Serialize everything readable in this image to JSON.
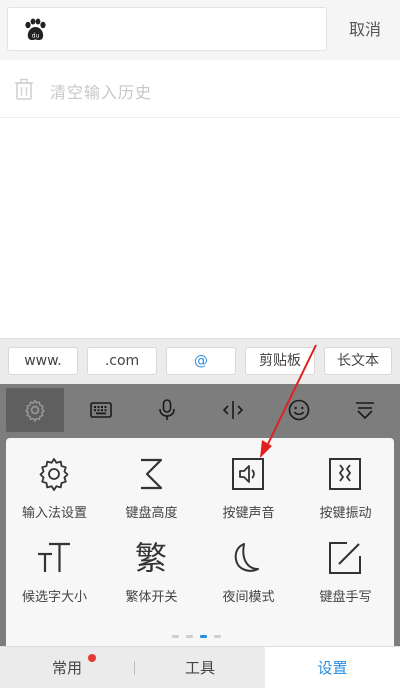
{
  "search": {
    "cancel_label": "取消"
  },
  "history": {
    "clear_label": "清空输入历史"
  },
  "chips": [
    {
      "label": "www."
    },
    {
      "label": ".com"
    },
    {
      "label": "@"
    },
    {
      "label": "剪贴板"
    },
    {
      "label": "长文本"
    }
  ],
  "toolbar": {
    "icons": [
      "gear-icon",
      "keyboard-icon",
      "microphone-icon",
      "cursor-icon",
      "emoji-icon",
      "collapse-icon"
    ]
  },
  "panel": {
    "items": [
      {
        "label": "输入法设置",
        "icon": "gear-icon"
      },
      {
        "label": "键盘高度",
        "icon": "height-icon"
      },
      {
        "label": "按键声音",
        "icon": "speaker-icon"
      },
      {
        "label": "按键振动",
        "icon": "vibrate-icon"
      },
      {
        "label": "候选字大小",
        "icon": "font-size-icon"
      },
      {
        "label": "繁体开关",
        "icon": "traditional-char-icon",
        "glyph": "繁"
      },
      {
        "label": "夜间模式",
        "icon": "moon-icon"
      },
      {
        "label": "键盘手写",
        "icon": "handwrite-icon"
      }
    ],
    "page_count": 4,
    "active_page": 3
  },
  "tabs": {
    "common": "常用",
    "tools": "工具",
    "settings": "设置",
    "active": "设置"
  },
  "colors": {
    "accent": "#2a8ee0",
    "toolbar_bg": "#7d7d7d",
    "badge": "#e53935",
    "annotation_arrow": "#e02020"
  }
}
